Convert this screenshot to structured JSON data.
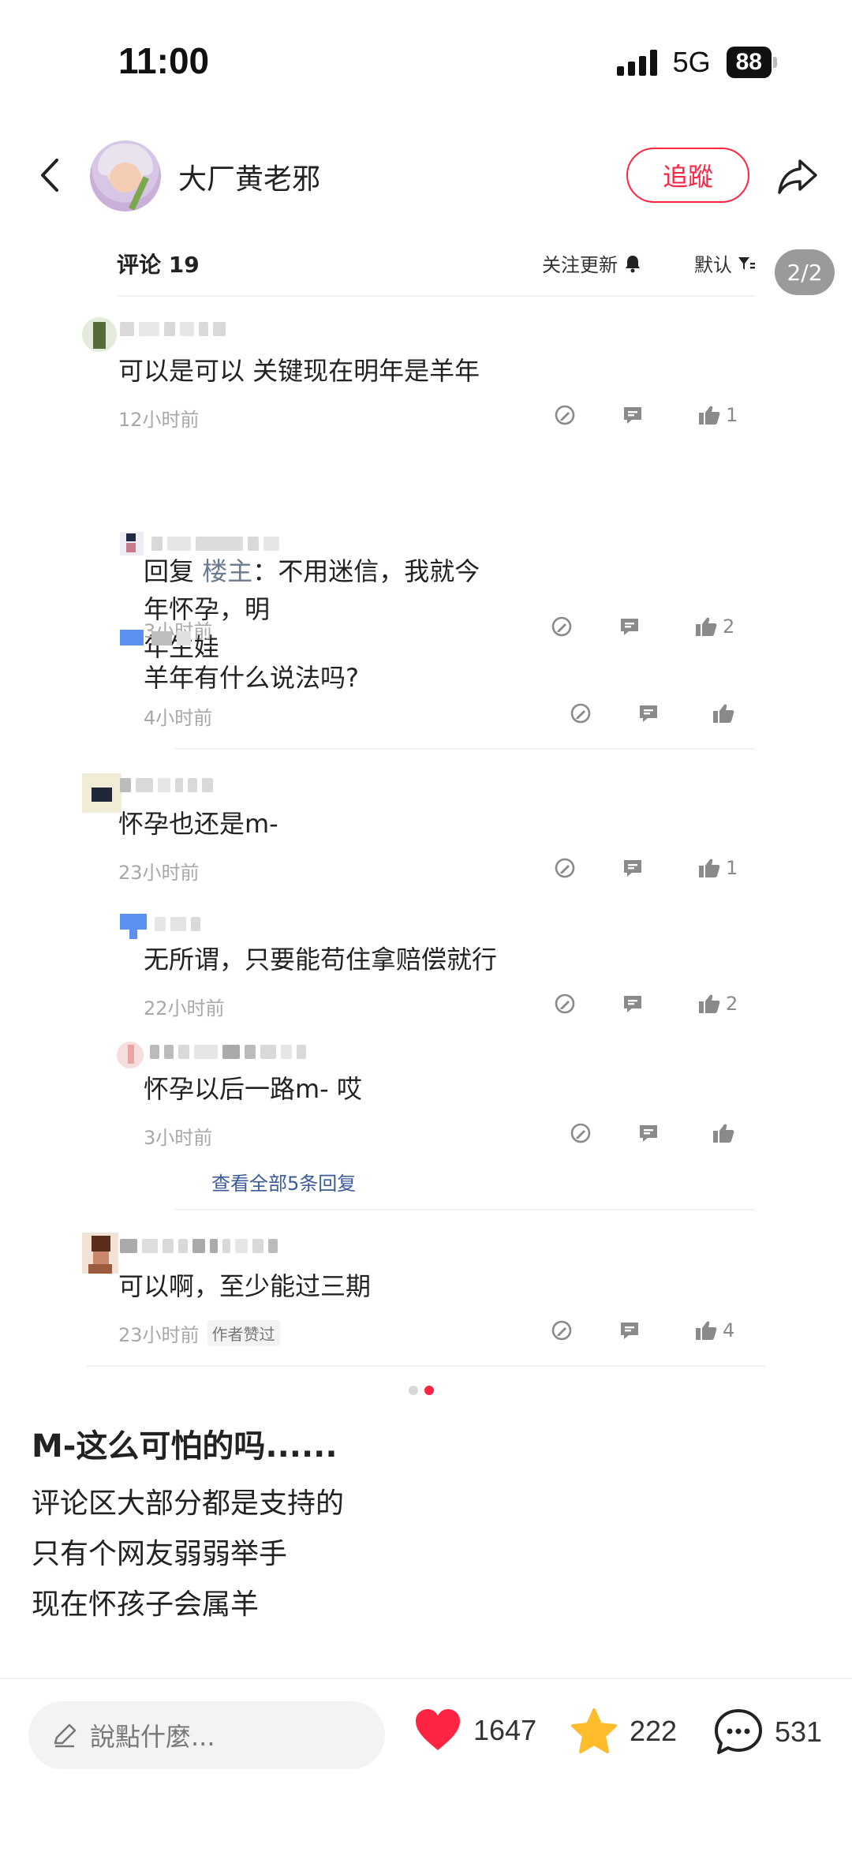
{
  "status_bar": {
    "time": "11:00",
    "network": "5G",
    "battery": "88"
  },
  "header": {
    "author_name": "大厂黄老邪",
    "follow_label": "追蹤"
  },
  "pager": "2/2",
  "comments_panel": {
    "title": "评论 19",
    "follow_updates": "关注更新",
    "sort": "默认",
    "threads": [
      {
        "text": "可以是可以 关键现在明年是羊年",
        "time": "12小时前",
        "likes": "1",
        "replies": [
          {
            "prefix": "回复 ",
            "reply_to": "楼主",
            "text_line1": "：不用迷信，我就今年怀孕，明",
            "text_line2": "年生娃",
            "time": "3小时前",
            "likes": "2"
          },
          {
            "text": "羊年有什么说法吗?",
            "time": "4小时前",
            "likes": ""
          }
        ]
      },
      {
        "text": "怀孕也还是m-",
        "time": "23小时前",
        "likes": "1",
        "replies": [
          {
            "text": "无所谓，只要能苟住拿赔偿就行",
            "time": "22小时前",
            "likes": "2"
          },
          {
            "text": "怀孕以后一路m- 哎",
            "time": "3小时前",
            "likes": ""
          }
        ],
        "view_all": "查看全部5条回复"
      },
      {
        "text": "可以啊，至少能过三期",
        "time": "23小时前",
        "badge": "作者赞过",
        "likes": "4"
      }
    ]
  },
  "post": {
    "title": "M-这么可怕的吗......",
    "body_lines": [
      "评论区大部分都是支持的",
      "只有个网友弱弱举手",
      "现在怀孩子会属羊"
    ]
  },
  "bottom_bar": {
    "input_placeholder": "說點什麼...",
    "likes": "1647",
    "favorites": "222",
    "comments": "531"
  },
  "colors": {
    "accent": "#ff2442",
    "star": "#fcbc2c",
    "heart": "#ff2442"
  }
}
